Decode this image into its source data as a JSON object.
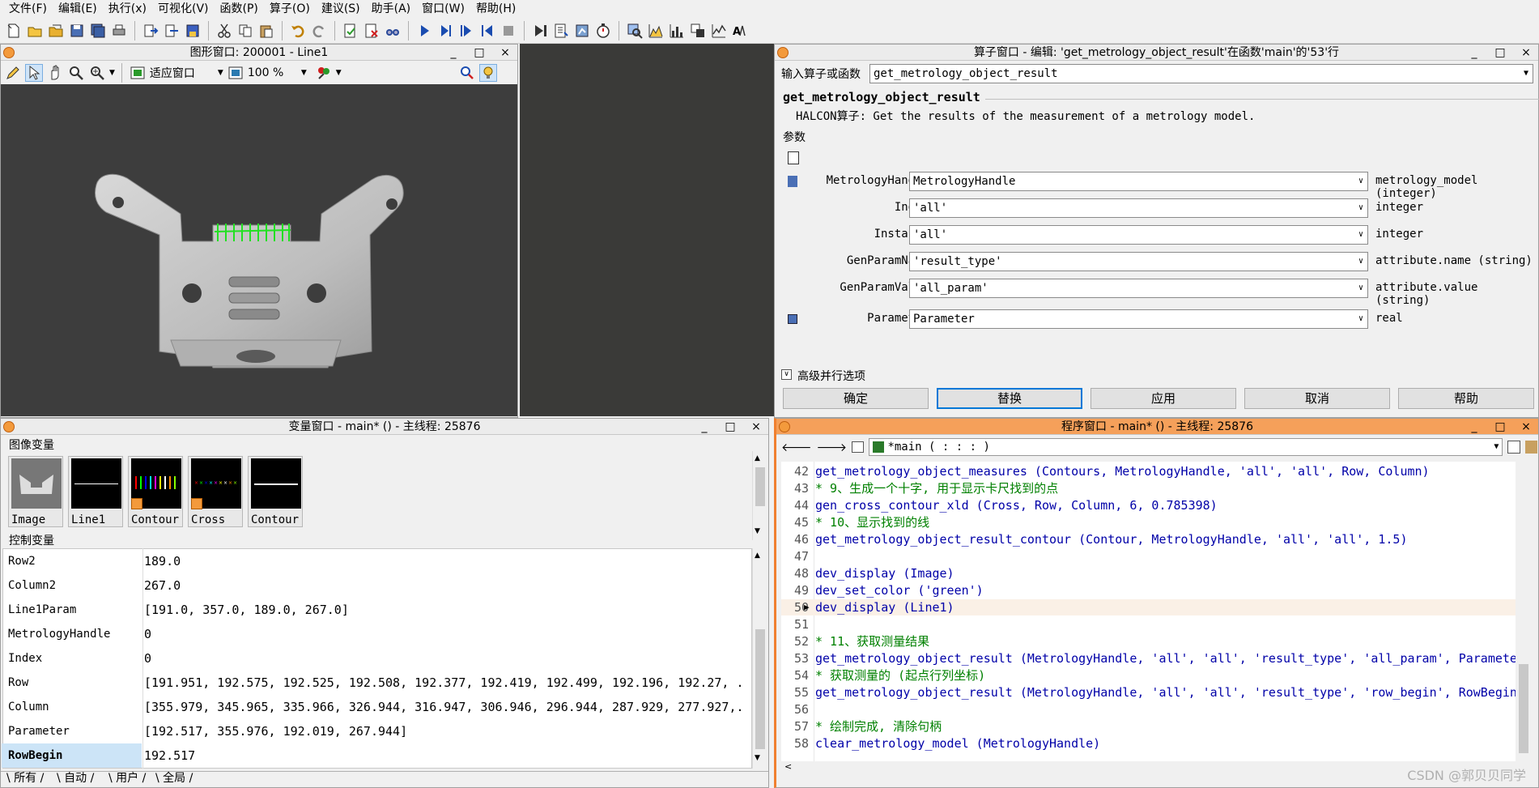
{
  "menubar": [
    "文件(F)",
    "编辑(E)",
    "执行(x)",
    "可视化(V)",
    "函数(P)",
    "算子(O)",
    "建议(S)",
    "助手(A)",
    "窗口(W)",
    "帮助(H)"
  ],
  "graphics_window": {
    "title": "图形窗口: 200001 - Line1",
    "fit_label": "适应窗口",
    "zoom_label": "100 %"
  },
  "operator_window": {
    "title": "算子窗口 - 编辑: 'get_metrology_object_result'在函数'main'的'53'行",
    "input_label": "输入算子或函数",
    "input_value": "get_metrology_object_result",
    "op_name": "get_metrology_object_result",
    "op_desc": "HALCON算子: Get the results of the measurement of a metrology model.",
    "params_label": "参数",
    "params": [
      {
        "name": "MetrologyHandle",
        "value": "MetrologyHandle",
        "type": "metrology_model (integer)"
      },
      {
        "name": "Index",
        "value": "'all'",
        "type": "integer"
      },
      {
        "name": "Instance",
        "value": "'all'",
        "type": "integer"
      },
      {
        "name": "GenParamName",
        "value": "'result_type'",
        "type": "attribute.name (string)"
      },
      {
        "name": "GenParamValue",
        "value": "'all_param'",
        "type": "attribute.value (string)"
      },
      {
        "name": "Parameter",
        "value": "Parameter",
        "type": "real"
      }
    ],
    "advanced_label": "高级并行选项",
    "buttons": [
      "确定",
      "替换",
      "应用",
      "取消",
      "帮助"
    ]
  },
  "variable_window": {
    "title": "变量窗口 - main* () - 主线程: 25876",
    "image_vars_label": "图像变量",
    "image_vars": [
      "Image",
      "Line1",
      "Contour",
      "Cross",
      "Contour"
    ],
    "control_vars_label": "控制变量",
    "control_vars": [
      {
        "name": "Row2",
        "value": "189.0"
      },
      {
        "name": "Column2",
        "value": "267.0"
      },
      {
        "name": "Line1Param",
        "value": "[191.0, 357.0, 189.0, 267.0]"
      },
      {
        "name": "MetrologyHandle",
        "value": "0"
      },
      {
        "name": "Index",
        "value": "0"
      },
      {
        "name": "Row",
        "value": "[191.951, 192.575, 192.525, 192.508, 192.377, 192.419, 192.499, 192.196, 192.27, ..."
      },
      {
        "name": "Column",
        "value": "[355.979, 345.965, 335.966, 326.944, 316.947, 306.946, 296.944, 287.929, 277.927,..."
      },
      {
        "name": "Parameter",
        "value": "[192.517, 355.976, 192.019, 267.944]"
      },
      {
        "name": "RowBegin",
        "value": "192.517"
      }
    ],
    "tabs": [
      "所有",
      "自动",
      "用户",
      "全局"
    ]
  },
  "program_window": {
    "title": "程序窗口 - main* () - 主线程: 25876",
    "procedure": "*main ( : : : )",
    "lines": [
      {
        "n": "42",
        "text": "get_metrology_object_measures (Contours, MetrologyHandle, 'all', 'all', Row, Column)",
        "kind": "op"
      },
      {
        "n": "43",
        "text": "* 9、生成一个十字, 用于显示卡尺找到的点",
        "kind": "comment"
      },
      {
        "n": "44",
        "text": "gen_cross_contour_xld (Cross, Row, Column, 6, 0.785398)",
        "kind": "op"
      },
      {
        "n": "45",
        "text": "* 10、显示找到的线",
        "kind": "comment"
      },
      {
        "n": "46",
        "text": "get_metrology_object_result_contour (Contour, MetrologyHandle, 'all', 'all', 1.5)",
        "kind": "op"
      },
      {
        "n": "47",
        "text": "",
        "kind": "op"
      },
      {
        "n": "48",
        "text": "dev_display (Image)",
        "kind": "op"
      },
      {
        "n": "49",
        "text": "dev_set_color ('green')",
        "kind": "op"
      },
      {
        "n": "50",
        "text": "dev_display (Line1)",
        "kind": "op"
      },
      {
        "n": "51",
        "text": "",
        "kind": "op"
      },
      {
        "n": "52",
        "text": "* 11、获取测量结果",
        "kind": "comment"
      },
      {
        "n": "53",
        "text": "get_metrology_object_result (MetrologyHandle, 'all', 'all', 'result_type', 'all_param', Parameter)",
        "kind": "op"
      },
      {
        "n": "54",
        "text": "* 获取测量的 (起点行列坐标)",
        "kind": "comment"
      },
      {
        "n": "55",
        "text": "get_metrology_object_result (MetrologyHandle, 'all', 'all', 'result_type', 'row_begin', RowBegin)",
        "kind": "op"
      },
      {
        "n": "56",
        "text": "",
        "kind": "op"
      },
      {
        "n": "57",
        "text": "* 绘制完成, 清除句柄",
        "kind": "comment"
      },
      {
        "n": "58",
        "text": "clear_metrology_model (MetrologyHandle)",
        "kind": "op"
      }
    ]
  },
  "watermark": "CSDN @郭贝贝同学",
  "colors": {
    "accent": "#0078d7",
    "comment": "#008000",
    "operator": "#0000a8",
    "program_title": "#f5a05a",
    "selected_var": "#cce4f7"
  }
}
